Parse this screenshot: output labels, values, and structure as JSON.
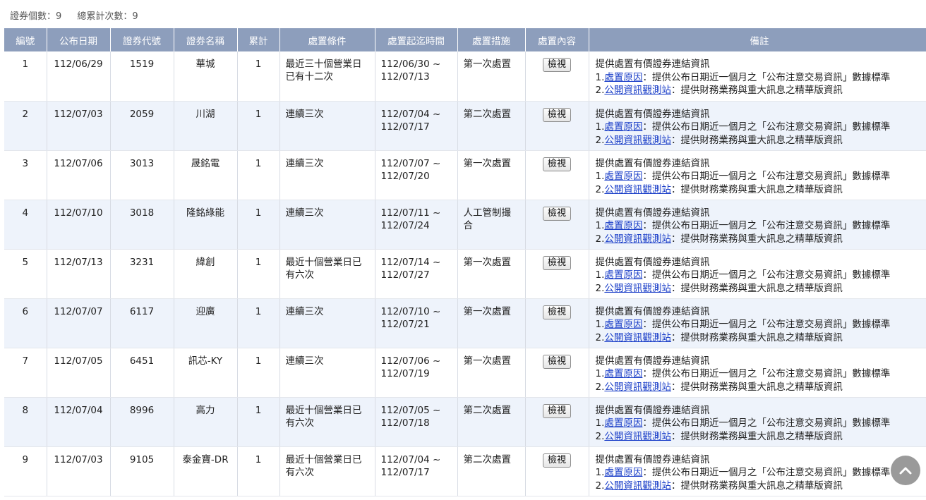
{
  "summary": {
    "count_label": "證券個數：9",
    "total_label": "總累計次數：9"
  },
  "table": {
    "headers": [
      "編號",
      "公布日期",
      "證券代號",
      "證券名稱",
      "累計",
      "處置條件",
      "處置起迄時間",
      "處置措施",
      "處置內容",
      "備註"
    ],
    "rows": [
      {
        "no": "1",
        "date": "112/06/29",
        "code": "1519",
        "name": "華城",
        "count": "1",
        "condition": "最近三十個營業日已有十二次",
        "period_start": "112/06/30 ~",
        "period_end": "112/07/13",
        "measure": "第一次處置",
        "button": "檢視"
      },
      {
        "no": "2",
        "date": "112/07/03",
        "code": "2059",
        "name": "川湖",
        "count": "1",
        "condition": "連續三次",
        "period_start": "112/07/04 ~",
        "period_end": "112/07/17",
        "measure": "第二次處置",
        "button": "檢視"
      },
      {
        "no": "3",
        "date": "112/07/06",
        "code": "3013",
        "name": "晟銘電",
        "count": "1",
        "condition": "連續三次",
        "period_start": "112/07/07 ~",
        "period_end": "112/07/20",
        "measure": "第一次處置",
        "button": "檢視"
      },
      {
        "no": "4",
        "date": "112/07/10",
        "code": "3018",
        "name": "隆銘綠能",
        "count": "1",
        "condition": "連續三次",
        "period_start": "112/07/11 ~",
        "period_end": "112/07/24",
        "measure": "人工管制撮合",
        "button": "檢視"
      },
      {
        "no": "5",
        "date": "112/07/13",
        "code": "3231",
        "name": "緯創",
        "count": "1",
        "condition": "最近十個營業日已有六次",
        "period_start": "112/07/14 ~",
        "period_end": "112/07/27",
        "measure": "第一次處置",
        "button": "檢視"
      },
      {
        "no": "6",
        "date": "112/07/07",
        "code": "6117",
        "name": "迎廣",
        "count": "1",
        "condition": "連續三次",
        "period_start": "112/07/10 ~",
        "period_end": "112/07/21",
        "measure": "第一次處置",
        "button": "檢視"
      },
      {
        "no": "7",
        "date": "112/07/05",
        "code": "6451",
        "name": "訊芯-KY",
        "count": "1",
        "condition": "連續三次",
        "period_start": "112/07/06 ~",
        "period_end": "112/07/19",
        "measure": "第一次處置",
        "button": "檢視"
      },
      {
        "no": "8",
        "date": "112/07/04",
        "code": "8996",
        "name": "高力",
        "count": "1",
        "condition": "最近十個營業日已有六次",
        "period_start": "112/07/05 ~",
        "period_end": "112/07/18",
        "measure": "第二次處置",
        "button": "檢視"
      },
      {
        "no": "9",
        "date": "112/07/03",
        "code": "9105",
        "name": "泰金寶-DR",
        "count": "1",
        "condition": "最近十個營業日已有六次",
        "period_start": "112/07/04 ~",
        "period_end": "112/07/17",
        "measure": "第二次處置",
        "button": "檢視"
      }
    ],
    "note": {
      "line1": "提供處置有價證券連結資訊",
      "l2_prefix": "1.",
      "l2_link": "處置原因",
      "l2_text": "：提供公布日期近一個月之「公布注意交易資訊」數據標準",
      "l3_prefix": "2.",
      "l3_link": "公開資訊觀測站",
      "l3_text": "：提供財務業務與重大訊息之精華版資訊"
    }
  },
  "scroll_top": {
    "icon": "chevron-up-icon",
    "color": "#7a7a7a"
  },
  "colors": {
    "header_bg": "#8d9ebc",
    "alt_row_bg": "#eef3fb",
    "link": "#1a3ec8"
  }
}
